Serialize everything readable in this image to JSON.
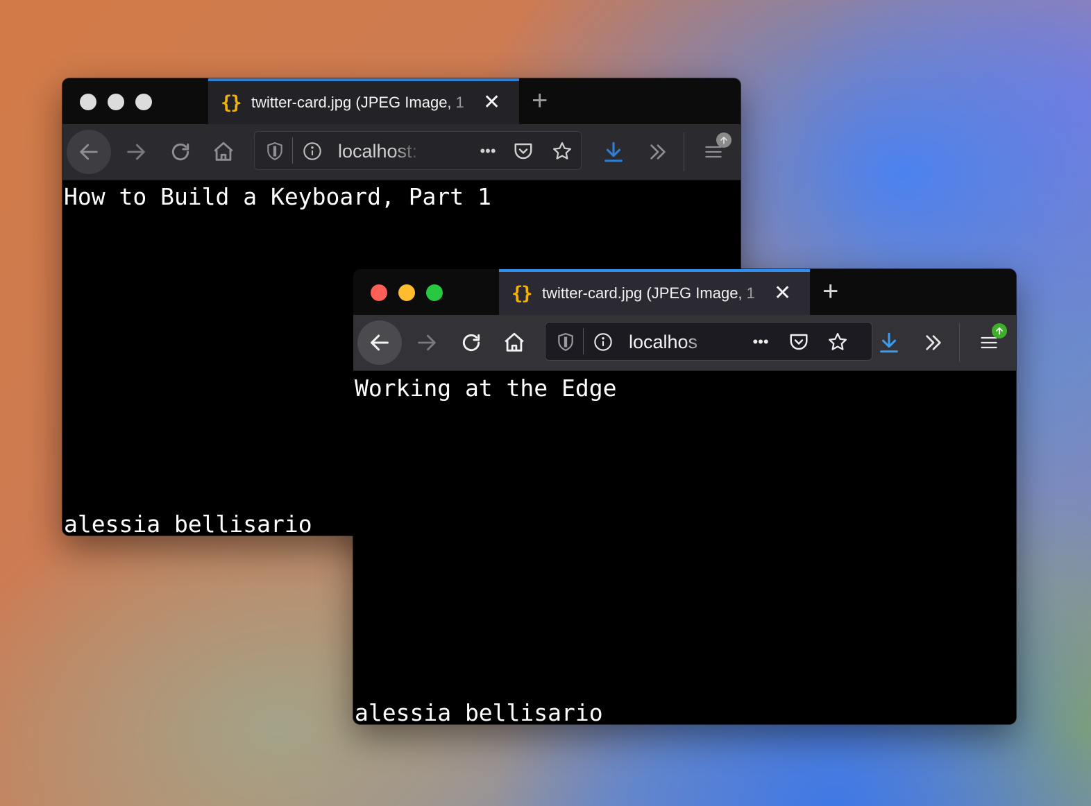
{
  "windows": [
    {
      "id": "back",
      "state": "inactive",
      "tab": {
        "icon": "json-braces-icon",
        "title": "twitter-card.jpg (JPEG Image, 1"
      },
      "address_bar": {
        "url": "localhost:"
      },
      "page": {
        "heading": "How to Build a Keyboard, Part 1",
        "author": "alessia bellisario"
      }
    },
    {
      "id": "front",
      "state": "active",
      "tab": {
        "icon": "json-braces-icon",
        "title": "twitter-card.jpg (JPEG Image, 1"
      },
      "address_bar": {
        "url": "localhos"
      },
      "page": {
        "heading": "Working at the Edge",
        "author": "alessia bellisario"
      }
    }
  ],
  "glyphs": {
    "tab_icon": "{}",
    "close": "✕",
    "new_tab": "+",
    "more": "•••"
  },
  "colors": {
    "tab_accent": "#2f8ff0",
    "tab_icon": "#f5b300",
    "download_icon": "#3a9bf0",
    "menu_badge_active": "#3fae2a",
    "close_red": "#fe5f57",
    "minimize_yellow": "#febc2e",
    "zoom_green": "#28c840"
  }
}
